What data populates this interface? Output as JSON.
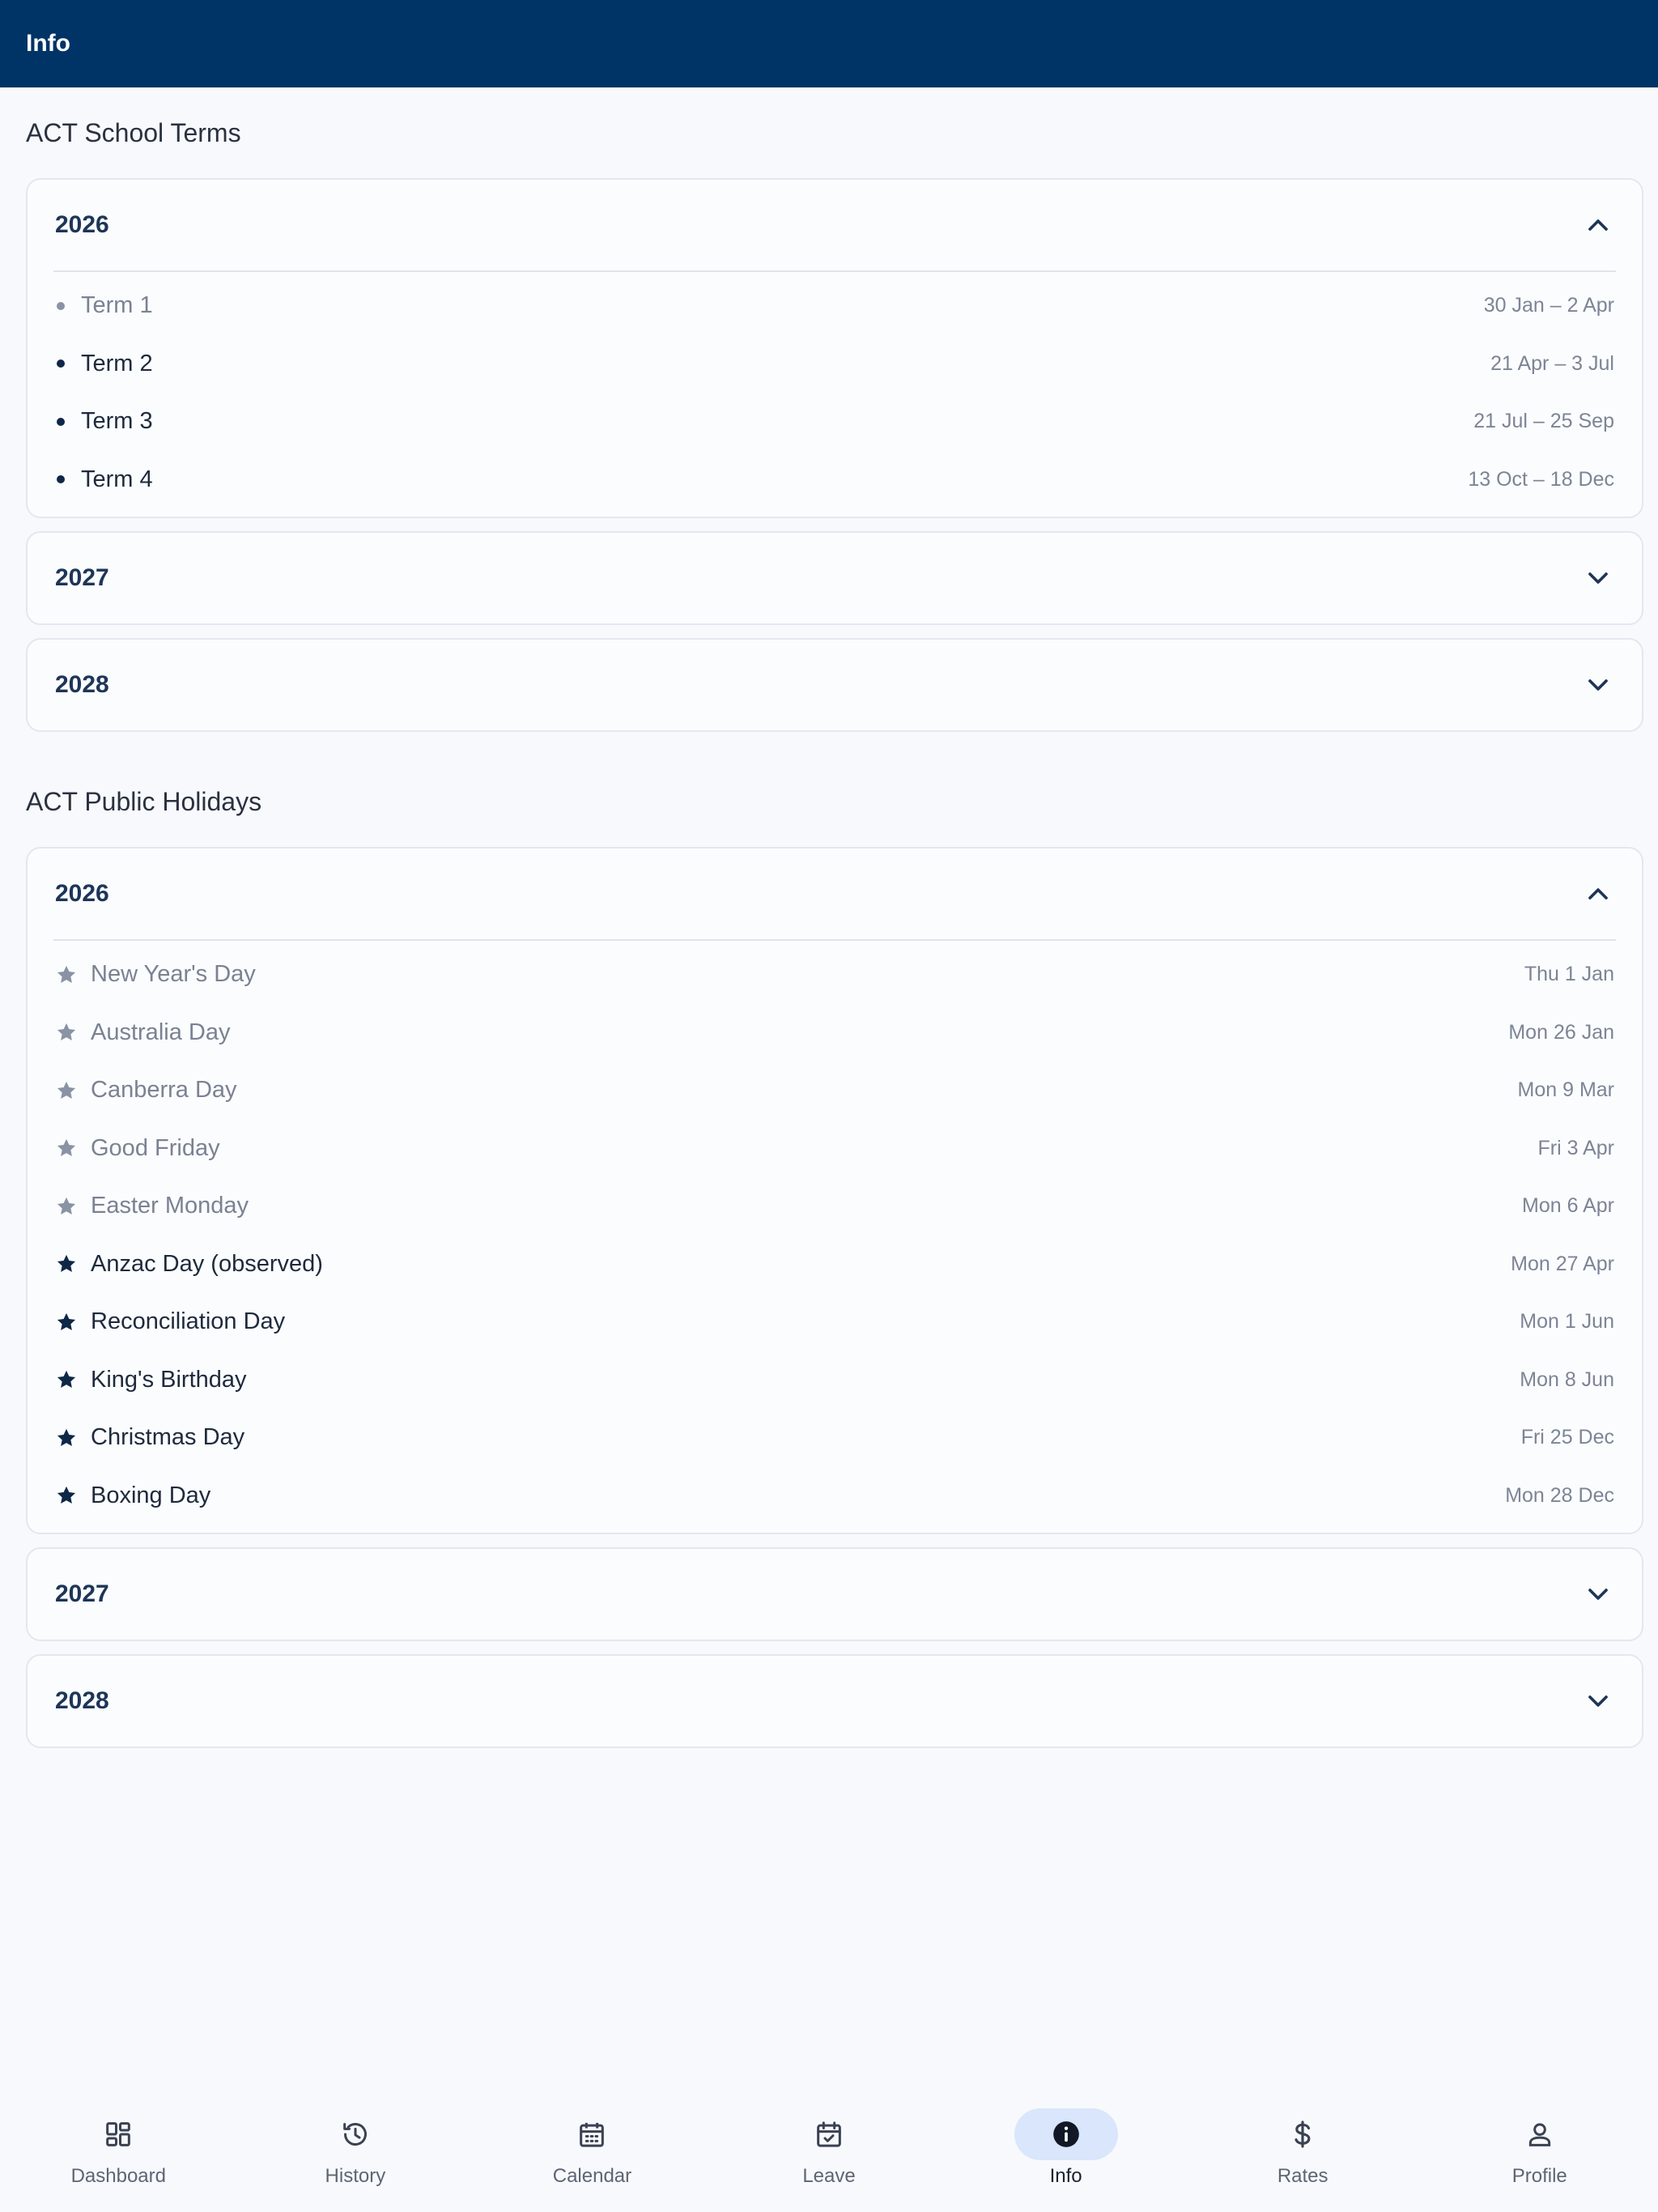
{
  "app_bar": {
    "title": "Info"
  },
  "school_terms": {
    "title": "ACT School Terms",
    "years": [
      {
        "year": "2026",
        "expanded": true,
        "items": [
          {
            "label": "Term 1",
            "date": "30 Jan – 2 Apr"
          },
          {
            "label": "Term 2",
            "date": "21 Apr – 3 Jul"
          },
          {
            "label": "Term 3",
            "date": "21 Jul – 25 Sep"
          },
          {
            "label": "Term 4",
            "date": "13 Oct – 18 Dec"
          }
        ]
      },
      {
        "year": "2027",
        "expanded": false
      },
      {
        "year": "2028",
        "expanded": false
      }
    ]
  },
  "public_holidays": {
    "title": "ACT Public Holidays",
    "years": [
      {
        "year": "2026",
        "expanded": true,
        "items": [
          {
            "label": "New Year's Day",
            "date": "Thu 1 Jan"
          },
          {
            "label": "Australia Day",
            "date": "Mon 26 Jan"
          },
          {
            "label": "Canberra Day",
            "date": "Mon 9 Mar"
          },
          {
            "label": "Good Friday",
            "date": "Fri 3 Apr"
          },
          {
            "label": "Easter Monday",
            "date": "Mon 6 Apr"
          },
          {
            "label": "Anzac Day (observed)",
            "date": "Mon 27 Apr"
          },
          {
            "label": "Reconciliation Day",
            "date": "Mon 1 Jun"
          },
          {
            "label": "King's Birthday",
            "date": "Mon 8 Jun"
          },
          {
            "label": "Christmas Day",
            "date": "Fri 25 Dec"
          },
          {
            "label": "Boxing Day",
            "date": "Mon 28 Dec"
          }
        ]
      },
      {
        "year": "2027",
        "expanded": false
      },
      {
        "year": "2028",
        "expanded": false
      }
    ]
  },
  "bottom_nav": {
    "items": [
      {
        "label": "Dashboard",
        "icon": "dashboard-icon"
      },
      {
        "label": "History",
        "icon": "history-icon"
      },
      {
        "label": "Calendar",
        "icon": "calendar-icon"
      },
      {
        "label": "Leave",
        "icon": "leave-icon"
      },
      {
        "label": "Info",
        "icon": "info-icon",
        "active": true
      },
      {
        "label": "Rates",
        "icon": "dollar-icon"
      },
      {
        "label": "Profile",
        "icon": "profile-icon"
      }
    ]
  },
  "colors": {
    "app_bar": "#003366",
    "accent": "#0f2747",
    "past_item": "#7a8292",
    "active_nav_pill": "#d9e6fb"
  }
}
